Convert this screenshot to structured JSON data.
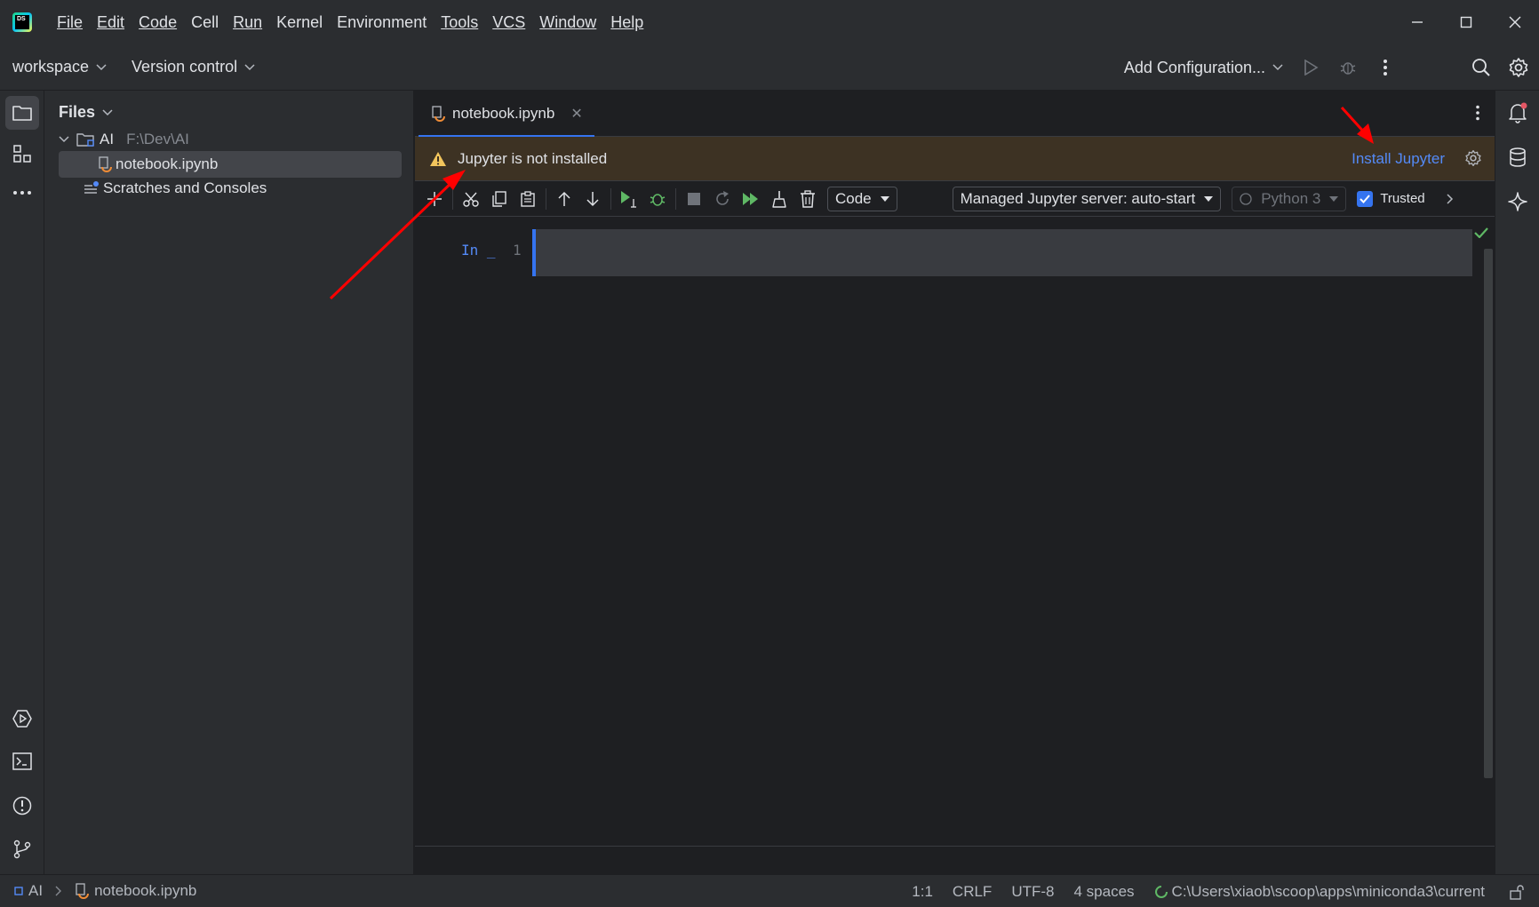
{
  "app": {
    "logo_text": "DS"
  },
  "menu": [
    "File",
    "Edit",
    "Code",
    "Cell",
    "Run",
    "Kernel",
    "Environment",
    "Tools",
    "VCS",
    "Window",
    "Help"
  ],
  "toolbar": {
    "project_label": "workspace",
    "vcs_label": "Version control",
    "config_label": "Add Configuration..."
  },
  "project_panel": {
    "title": "Files",
    "root_name": "AI",
    "root_path": "F:\\Dev\\AI",
    "file_name": "notebook.ipynb",
    "scratches_label": "Scratches and Consoles"
  },
  "editor": {
    "tab_label": "notebook.ipynb",
    "banner_text": "Jupyter is not installed",
    "banner_action": "Install Jupyter",
    "cell_type": "Code",
    "server_label": "Managed Jupyter server: auto-start",
    "kernel_label": "Python 3",
    "trusted_label": "Trusted",
    "cell_prompt": "In _",
    "line_number": "1"
  },
  "statusbar": {
    "crumb_root": "AI",
    "crumb_file": "notebook.ipynb",
    "position": "1:1",
    "line_sep": "CRLF",
    "encoding": "UTF-8",
    "indent": "4 spaces",
    "interpreter": "C:\\Users\\xiaob\\scoop\\apps\\miniconda3\\current"
  },
  "colors": {
    "accent": "#3574f0",
    "link": "#548af7",
    "banner_bg": "#3d3223",
    "warning": "#f2c55c",
    "run_green": "#5fb865",
    "annotation_red": "#ff0000"
  }
}
